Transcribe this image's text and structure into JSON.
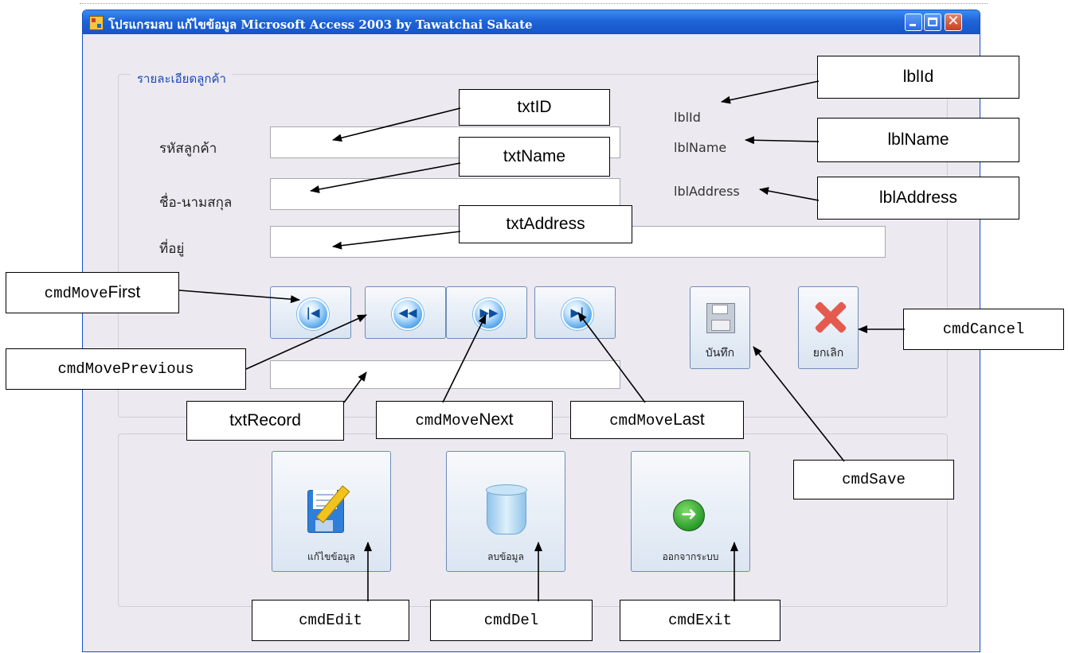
{
  "window": {
    "title": "โปรแกรมลบ แก้ไขข้อมูล  Microsoft  Access 2003   by  Tawatchai  Sakate"
  },
  "group": {
    "title": "รายละเอียดลูกค้า"
  },
  "fields": {
    "customer_id_label": "รหัสลูกค้า",
    "name_label": "ชื่อ-นามสกุล",
    "address_label": "ที่อยู่"
  },
  "labels": {
    "lblId": "lblId",
    "lblName": "lblName",
    "lblAddress": "lblAddress"
  },
  "buttons": {
    "save": "บันทึก",
    "cancel": "ยกเลิก",
    "edit": "แก้ไขข้อมูล",
    "delete": "ลบข้อมูล",
    "exit": "ออกจากระบบ"
  },
  "callouts": {
    "txtID": "txtID",
    "txtName": "txtName",
    "txtAddress": "txtAddress",
    "lblId": "lblId",
    "lblName": "lblName",
    "lblAddress": "lblAddress",
    "cmdMove_prefix": "cmdMove",
    "first": "First",
    "cmdMovePrevious": "cmdMovePrevious",
    "txtRecord": "txtRecord",
    "next": "Next",
    "last": "Last",
    "cmdCancel": "cmdCancel",
    "cmdSave": "cmdSave",
    "cmdEdit": "cmdEdit",
    "cmdDel": "cmdDel",
    "cmdExit": "cmdExit"
  },
  "icons": [
    "app-icon",
    "minimize-icon",
    "maximize-icon",
    "close-icon",
    "move-first-icon",
    "move-previous-icon",
    "move-next-icon",
    "move-last-icon",
    "floppy-save-icon",
    "cancel-x-icon",
    "edit-document-icon",
    "trash-bin-icon",
    "exit-arrow-icon"
  ]
}
